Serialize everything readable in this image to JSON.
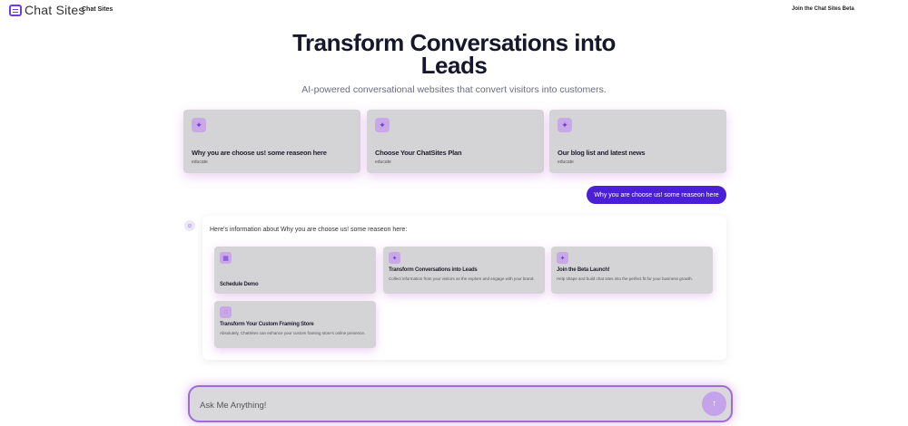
{
  "header": {
    "logo_text": "Chat Sites",
    "nav_label": "Chat Sites",
    "beta_link": "Join the Chat Sites Beta"
  },
  "hero": {
    "title_line1": "Transform Conversations into",
    "title_line2": "Leads",
    "subtitle": "AI-powered conversational websites that convert visitors into customers."
  },
  "suggestions": [
    {
      "title": "Why you are choose us! some reaseon here",
      "tag": "educate",
      "icon": "sparkle-icon"
    },
    {
      "title": "Choose Your ChatSites Plan",
      "tag": "educate",
      "icon": "sparkle-icon"
    },
    {
      "title": "Our blog list and latest news",
      "tag": "educate",
      "icon": "sparkle-icon"
    }
  ],
  "chat": {
    "user_message": "Why you are choose us! some reaseon here",
    "assistant_intro": "Here's information about Why you are choose us! some reaseon here:",
    "cards": [
      {
        "title": "Schedule Demo",
        "description": "",
        "icon": "calendar-icon"
      },
      {
        "title": "Transform Conversations into Leads",
        "description": "Collect information from your visitors as the explore and engage with your brand.",
        "icon": "sparkle-icon"
      },
      {
        "title": "Join the Beta Launch!",
        "description": "Help shape and build chat sites into the perfect fit for your business growth.",
        "icon": "sparkle-icon"
      },
      {
        "title": "Transform Your Custom Framing Store",
        "description": "Absolutely, ChatSites can enhance your custom framing store's online presence.",
        "icon": "message-icon"
      }
    ]
  },
  "input": {
    "placeholder": "Ask Me Anything!",
    "value": ""
  },
  "colors": {
    "accent": "#4a1fd6",
    "card_bg": "#d4d4d6",
    "icon_bg": "#c9a8e8",
    "glow": "#a06ad8"
  }
}
